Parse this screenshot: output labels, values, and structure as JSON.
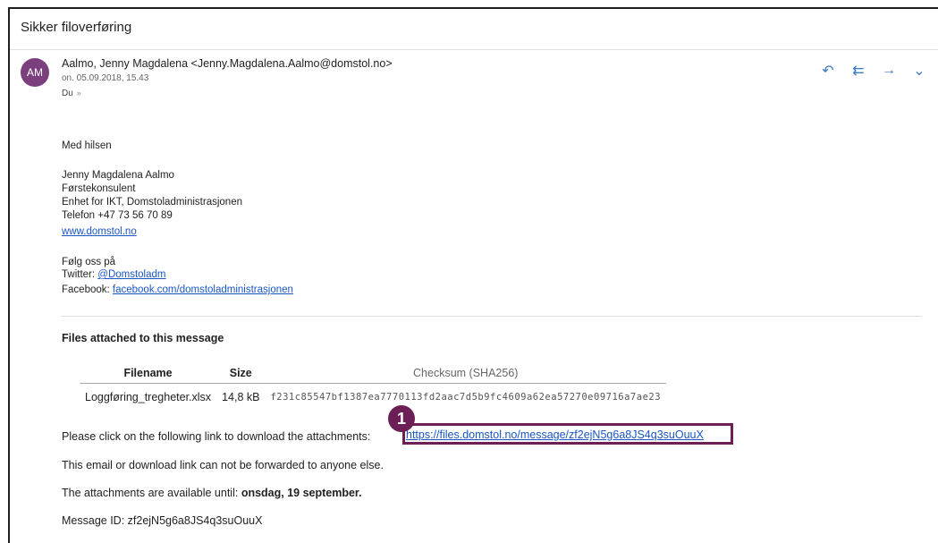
{
  "subject": "Sikker filoverføring",
  "sender": {
    "initials": "AM",
    "name_line": "Aalmo, Jenny Magdalena <Jenny.Magdalena.Aalmo@domstol.no>",
    "date": "on. 05.09.2018, 15.43",
    "to": "Du",
    "to_chevron": "»"
  },
  "actions": [
    {
      "icon": "reply-icon",
      "glyph": "↶"
    },
    {
      "icon": "reply-all-icon",
      "glyph": "⇇"
    },
    {
      "icon": "forward-icon",
      "glyph": "→"
    },
    {
      "icon": "more-chevron-icon",
      "glyph": "⌄"
    }
  ],
  "signature": {
    "greeting": "Med hilsen",
    "name": "Jenny Magdalena Aalmo",
    "title": "Førstekonsulent",
    "unit": "Enhet for IKT, Domstoladministrasjonen",
    "phone": "Telefon +47 73 56 70 89",
    "website": "www.domstol.no",
    "follow": "Følg oss på",
    "twitter_label": "Twitter: ",
    "twitter_handle": "@Domstoladm",
    "facebook_label": "Facebook: ",
    "facebook_link": "facebook.com/domstoladministrasjonen"
  },
  "files": {
    "title": "Files attached to this message",
    "headers": {
      "filename": "Filename",
      "size": "Size",
      "checksum": "Checksum (SHA256)"
    },
    "rows": [
      {
        "filename": "Loggføring_tregheter.xlsx",
        "size": "14,8 kB",
        "checksum": "f231c85547bf1387ea7770113fd2aac7d5b9fc4609a62ea57270e09716a7ae23"
      }
    ]
  },
  "download": {
    "text": "Please click on the following link to download the attachments:",
    "url": "https://files.domstol.no/message/zf2ejN5g6a8JS4q3suOuuX",
    "marker": "1"
  },
  "no_forward": "This email or download link can not be forwarded to anyone else.",
  "available": {
    "label": "The attachments are available until: ",
    "date": "onsdag, 19 september."
  },
  "message_id": "Message ID: zf2ejN5g6a8JS4q3suOuuX"
}
